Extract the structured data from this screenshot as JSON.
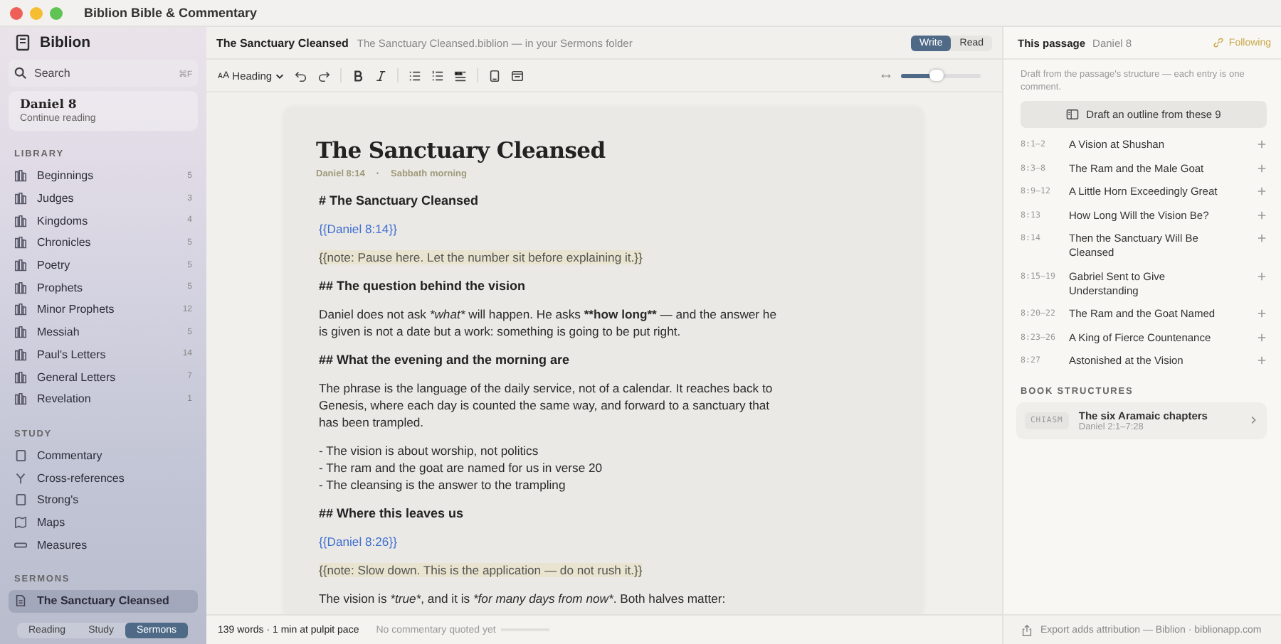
{
  "window": {
    "title": "Biblion Bible & Commentary"
  },
  "sidebar": {
    "app_name": "Biblion",
    "search": {
      "placeholder": "Search",
      "shortcut": "⌘F"
    },
    "current": {
      "title": "Daniel 8",
      "subtitle": "Continue reading"
    },
    "sections": [
      {
        "title": "LIBRARY",
        "kind": "library",
        "items": [
          {
            "label": "Beginnings",
            "count": "5",
            "selected": false
          },
          {
            "label": "Judges",
            "count": "3",
            "selected": false
          },
          {
            "label": "Kingdoms",
            "count": "4",
            "selected": false
          },
          {
            "label": "Chronicles",
            "count": "5",
            "selected": false
          },
          {
            "label": "Poetry",
            "count": "5",
            "selected": false
          },
          {
            "label": "Prophets",
            "count": "5",
            "selected": false
          },
          {
            "label": "Minor Prophets",
            "count": "12",
            "selected": false
          },
          {
            "label": "Messiah",
            "count": "5",
            "selected": false
          },
          {
            "label": "Paul's Letters",
            "count": "14",
            "selected": false
          },
          {
            "label": "General Letters",
            "count": "7",
            "selected": false
          },
          {
            "label": "Revelation",
            "count": "1",
            "selected": false
          }
        ]
      },
      {
        "title": "STUDY",
        "kind": "study",
        "items": [
          {
            "label": "Commentary",
            "selected": false
          },
          {
            "label": "Cross-references",
            "selected": false
          },
          {
            "label": "Strong's",
            "selected": false
          },
          {
            "label": "Maps",
            "selected": false
          },
          {
            "label": "Measures",
            "selected": false
          }
        ]
      },
      {
        "title": "SERMONS",
        "kind": "sermons",
        "items": [
          {
            "label": "The Sanctuary Cleansed",
            "selected": true
          }
        ]
      }
    ],
    "tabs": [
      {
        "label": "Reading",
        "selected": false
      },
      {
        "label": "Study",
        "selected": false
      },
      {
        "label": "Sermons",
        "selected": true
      }
    ]
  },
  "editor": {
    "title": "The Sanctuary Cleansed",
    "path": "The Sanctuary Cleansed.biblion — in your Sermons folder",
    "modes": [
      {
        "label": "Write",
        "selected": true
      },
      {
        "label": "Read",
        "selected": false
      }
    ],
    "toolbar": {
      "style_glyph": "ᴀA",
      "style": "Heading",
      "width_slider": {
        "level": 0.45
      }
    },
    "document": {
      "title": "The Sanctuary Cleansed",
      "reference": "Daniel 8:14",
      "separator": "·",
      "occasion": "Sabbath morning",
      "blocks": [
        {
          "kind": "h1",
          "text": "# The Sanctuary Cleansed"
        },
        {
          "kind": "ref",
          "text": "{{Daniel 8:14}}"
        },
        {
          "kind": "note",
          "text": "{{note: Pause here. Let the number sit before explaining it.}}"
        },
        {
          "kind": "h2",
          "text": "## The question behind the vision"
        },
        {
          "kind": "para",
          "segments": [
            {
              "kind": "plain",
              "text": "Daniel does not ask "
            },
            {
              "kind": "italic",
              "text": "*what*"
            },
            {
              "kind": "plain",
              "text": " will happen. He asks "
            },
            {
              "kind": "bold",
              "text": "**how long**"
            },
            {
              "kind": "plain",
              "text": " — and the answer he is given is not a date but a work: something is going to be put right."
            }
          ]
        },
        {
          "kind": "h2",
          "text": "## What the evening and the morning are"
        },
        {
          "kind": "para",
          "segments": [
            {
              "kind": "plain",
              "text": "The phrase is the language of the daily service, not of a calendar. It reaches back to Genesis, where each day is counted the same way, and forward to a sanctuary that has been trampled."
            }
          ]
        },
        {
          "kind": "list",
          "items": [
            "- The vision is about worship, not politics",
            "- The ram and the goat are named for us in verse 20",
            "- The cleansing is the answer to the trampling"
          ]
        },
        {
          "kind": "h2",
          "text": "## Where this leaves us"
        },
        {
          "kind": "ref",
          "text": "{{Daniel 8:26}}"
        },
        {
          "kind": "note",
          "text": "{{note: Slow down. This is the application — do not rush it.}}"
        },
        {
          "kind": "para",
          "segments": [
            {
              "kind": "plain",
              "text": "The vision is "
            },
            {
              "kind": "italic",
              "text": "*true*"
            },
            {
              "kind": "plain",
              "text": ", and it is "
            },
            {
              "kind": "italic",
              "text": "*for many days from now*"
            },
            {
              "kind": "plain",
              "text": ". Both halves matter:"
            }
          ]
        }
      ]
    },
    "status": {
      "words": "139 words · 1 min at pulpit pace",
      "commentary": "No commentary quoted yet"
    }
  },
  "panel": {
    "title": "This passage",
    "passage": "Daniel 8",
    "follow": "Following",
    "intro": "Draft from the passage's structure — each entry is one comment.",
    "draft_button": "Draft an outline from these 9",
    "outline": [
      {
        "ref": "8:1–2",
        "title": "A Vision at Shushan"
      },
      {
        "ref": "8:3–8",
        "title": "The Ram and the Male Goat"
      },
      {
        "ref": "8:9–12",
        "title": "A Little Horn Exceedingly Great"
      },
      {
        "ref": "8:13",
        "title": "How Long Will the Vision Be?"
      },
      {
        "ref": "8:14",
        "title": "Then the Sanctuary Will Be Cleansed"
      },
      {
        "ref": "8:15–19",
        "title": "Gabriel Sent to Give Understanding"
      },
      {
        "ref": "8:20–22",
        "title": "The Ram and the Goat Named"
      },
      {
        "ref": "8:23–26",
        "title": "A King of Fierce Countenance"
      },
      {
        "ref": "8:27",
        "title": "Astonished at the Vision"
      }
    ],
    "structures_title": "BOOK STRUCTURES",
    "structures": [
      {
        "tag": "CHIASM",
        "title": "The six Aramaic chapters",
        "range": "Daniel 2:1–7:28"
      }
    ],
    "footer": "Export adds attribution — Biblion · biblionapp.com"
  }
}
